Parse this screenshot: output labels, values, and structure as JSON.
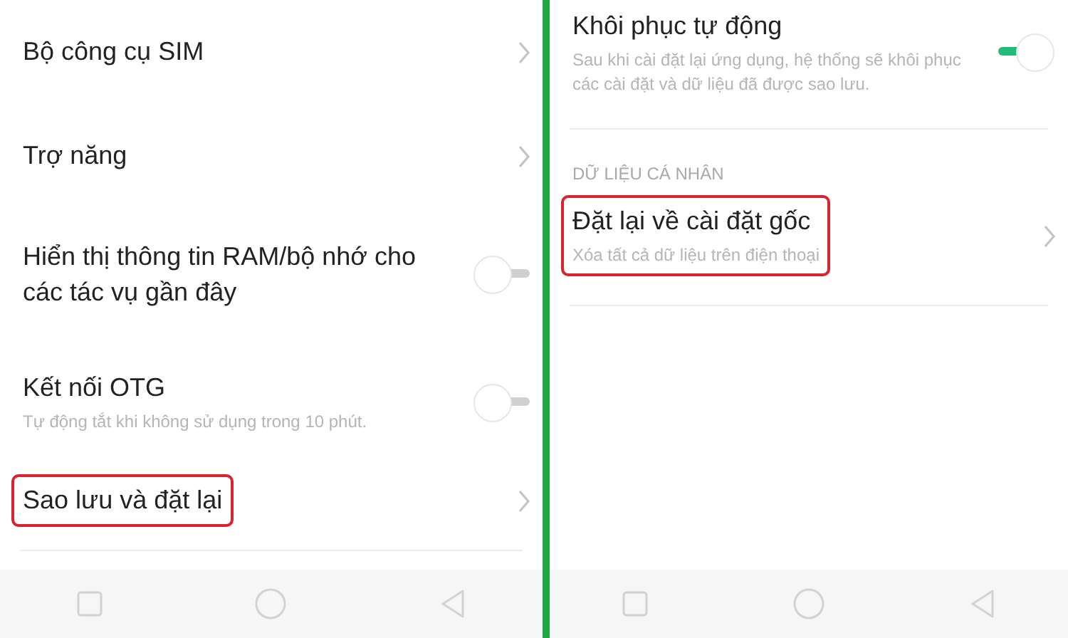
{
  "panels": [
    {
      "items": [
        {
          "kind": "link",
          "title": "Bộ công cụ SIM",
          "highlighted": false
        },
        {
          "kind": "link",
          "title": "Trợ năng",
          "highlighted": false
        },
        {
          "kind": "toggle",
          "title": "Hiển thị thông tin RAM/bộ nhớ cho các tác vụ gần đây",
          "on": false,
          "highlighted": false
        },
        {
          "kind": "toggle",
          "title": "Kết nối OTG",
          "subtitle": "Tự động tắt khi không sử dụng trong 10 phút.",
          "on": false,
          "highlighted": false
        },
        {
          "kind": "link",
          "title": "Sao lưu và đặt lại",
          "highlighted": true
        },
        {
          "kind": "divider"
        }
      ]
    },
    {
      "items": [
        {
          "kind": "toggle",
          "title": "Khôi phục tự động",
          "subtitle": "Sau khi cài đặt lại ứng dụng, hệ thống sẽ khôi phục các cài đặt và dữ liệu đã được sao lưu.",
          "on": true,
          "highlighted": false
        },
        {
          "kind": "divider"
        },
        {
          "kind": "header",
          "title": "DỮ LIỆU CÁ NHÂN"
        },
        {
          "kind": "link",
          "title": "Đặt lại về cài đặt gốc",
          "subtitle": "Xóa tất cả dữ liệu trên điện thoại",
          "highlighted": true
        },
        {
          "kind": "divider"
        }
      ]
    }
  ]
}
